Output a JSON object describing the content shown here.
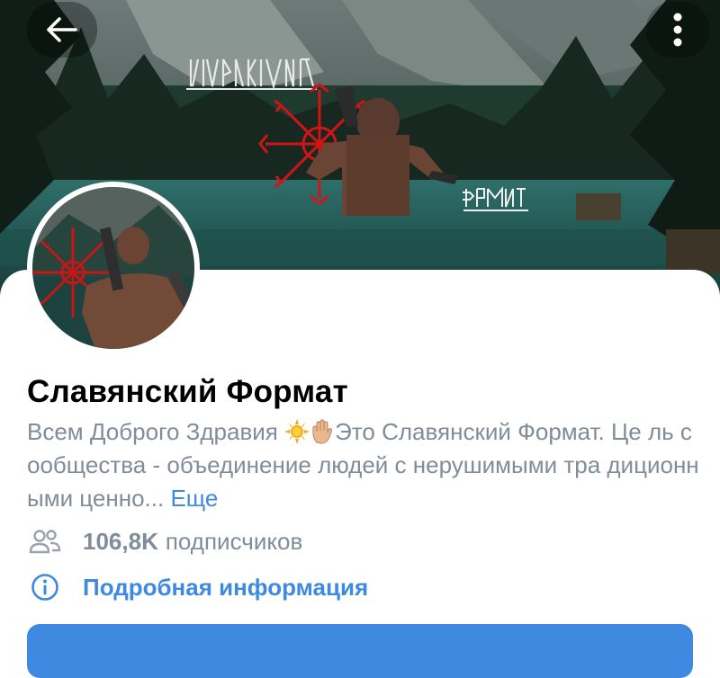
{
  "header": {
    "back_icon": "arrow-left-icon",
    "more_icon": "more-vertical-icon"
  },
  "cover": {
    "rune_title": "ᛊᛚᚨᚹᛃᚨᚾᛊᚲᛁᛃ",
    "rune_subtitle": "ᚠᛟᚱᛗᚨᛏ"
  },
  "profile": {
    "name": "Славянский Формат",
    "description_part1": "Всем Доброго Здравия ",
    "description_part2": "Это Славянский Формат. Це ль сообщества - объединение людей с нерушимыми тра диционными ценно...",
    "more_label": "Еще",
    "subscribers_count": "106,8K",
    "subscribers_label": "подписчиков",
    "info_label": "Подробная информация"
  },
  "colors": {
    "accent": "#3f8ae0",
    "secondary_text": "#818c99",
    "name_text": "#000000"
  }
}
